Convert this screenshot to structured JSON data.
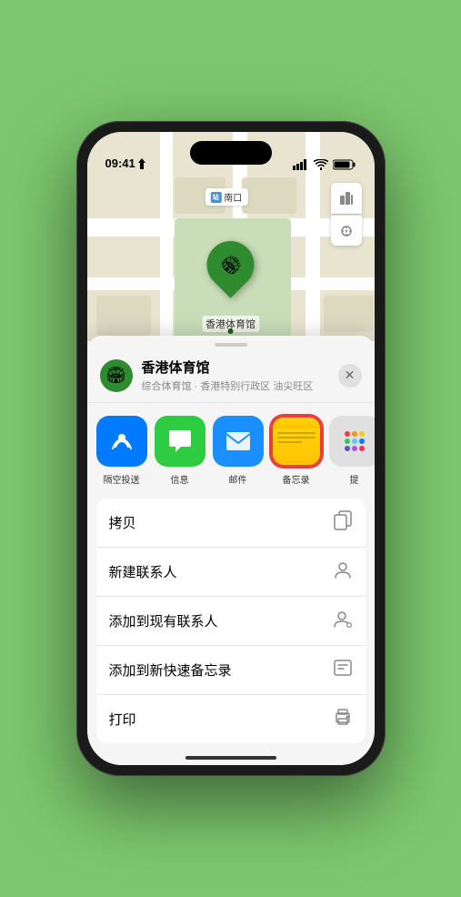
{
  "status_bar": {
    "time": "09:41",
    "location_icon": "▶"
  },
  "map": {
    "station_label": "南口",
    "pin_emoji": "🏟",
    "place_name_pin": "香港体育馆"
  },
  "sheet": {
    "place_name": "香港体育馆",
    "place_subtitle": "综合体育馆 · 香港特别行政区 油尖旺区",
    "close_label": "✕"
  },
  "share_items": [
    {
      "id": "airdrop",
      "label": "隔空投送",
      "emoji": "📡"
    },
    {
      "id": "messages",
      "label": "信息",
      "emoji": "💬"
    },
    {
      "id": "mail",
      "label": "邮件",
      "emoji": "✉️"
    },
    {
      "id": "notes",
      "label": "备忘录",
      "emoji": ""
    },
    {
      "id": "more",
      "label": "提",
      "emoji": ""
    }
  ],
  "action_items": [
    {
      "label": "拷贝",
      "icon": "📋"
    },
    {
      "label": "新建联系人",
      "icon": "👤"
    },
    {
      "label": "添加到现有联系人",
      "icon": "👤"
    },
    {
      "label": "添加到新快速备忘录",
      "icon": "🗒"
    },
    {
      "label": "打印",
      "icon": "🖨"
    }
  ]
}
